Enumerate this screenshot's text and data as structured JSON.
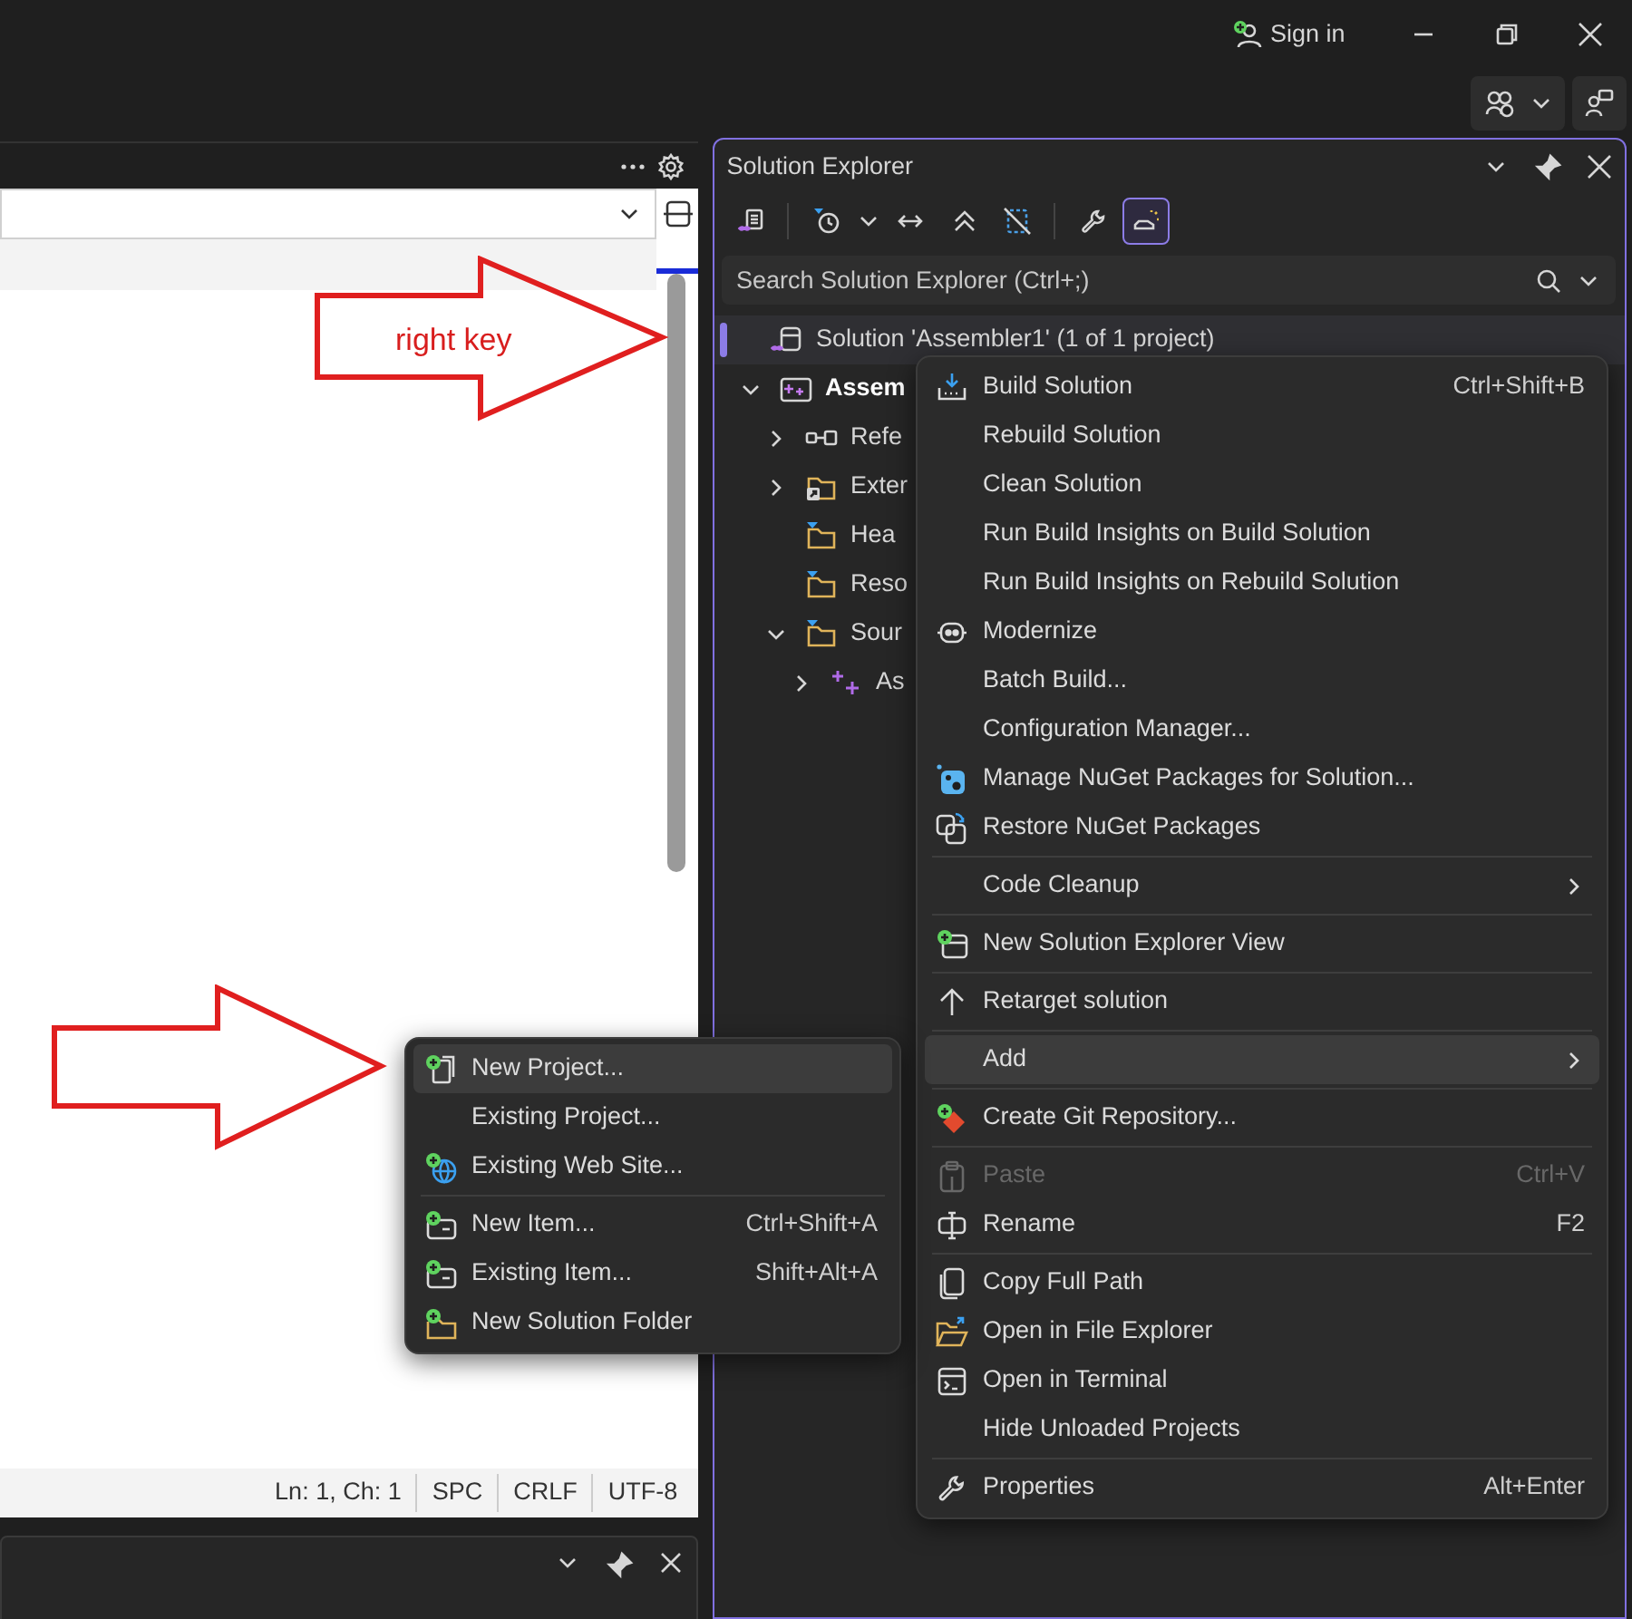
{
  "title_bar": {
    "sign_in": "Sign in"
  },
  "editor": {
    "status_bar": [
      "Ln: 1, Ch: 1",
      "SPC",
      "CRLF",
      "UTF-8"
    ]
  },
  "annotations": [
    {
      "kind": "labeled_arrow",
      "label": "right key"
    },
    {
      "kind": "arrow"
    }
  ],
  "solution_explorer": {
    "title": "Solution Explorer",
    "toolbar": [
      {
        "selected": false
      },
      {
        "selected": false
      },
      {
        "selected": false
      },
      {
        "selected": false
      },
      {
        "selected": false
      },
      {
        "selected": false
      },
      {
        "selected": true
      }
    ],
    "search": {
      "placeholder": "Search Solution Explorer (Ctrl+;)"
    },
    "tree": [
      {
        "kind": "solution",
        "label": "Solution 'Assembler1' (1 of 1 project)",
        "selected": true,
        "children": [
          {
            "kind": "project",
            "label": "Assem",
            "selected": false,
            "expanded": true,
            "children": [
              {
                "kind": "references",
                "label": "Refe",
                "selected": false,
                "expanded": false
              },
              {
                "kind": "external",
                "label": "Exter",
                "selected": false,
                "expanded": false
              },
              {
                "kind": "filter",
                "label": "Hea",
                "selected": false
              },
              {
                "kind": "filter",
                "label": "Reso",
                "selected": false
              },
              {
                "kind": "filter",
                "label": "Sour",
                "selected": false,
                "expanded": true,
                "children": [
                  {
                    "kind": "file",
                    "label": "As",
                    "selected": false,
                    "expanded": false
                  }
                ]
              }
            ]
          }
        ]
      }
    ]
  },
  "context_menu": {
    "items": [
      {
        "kind": "item",
        "label": "Build Solution",
        "shortcut": "Ctrl+Shift+B",
        "selected": false,
        "disabled": false,
        "submenu": false
      },
      {
        "kind": "item",
        "label": "Rebuild Solution",
        "selected": false,
        "disabled": false,
        "submenu": false
      },
      {
        "kind": "item",
        "label": "Clean Solution",
        "selected": false,
        "disabled": false,
        "submenu": false
      },
      {
        "kind": "item",
        "label": "Run Build Insights on Build Solution",
        "selected": false,
        "disabled": false,
        "submenu": false
      },
      {
        "kind": "item",
        "label": "Run Build Insights on Rebuild Solution",
        "selected": false,
        "disabled": false,
        "submenu": false
      },
      {
        "kind": "item",
        "label": "Modernize",
        "selected": false,
        "disabled": false,
        "submenu": false
      },
      {
        "kind": "item",
        "label": "Batch Build...",
        "selected": false,
        "disabled": false,
        "submenu": false
      },
      {
        "kind": "item",
        "label": "Configuration Manager...",
        "selected": false,
        "disabled": false,
        "submenu": false
      },
      {
        "kind": "item",
        "label": "Manage NuGet Packages for Solution...",
        "selected": false,
        "disabled": false,
        "submenu": false
      },
      {
        "kind": "item",
        "label": "Restore NuGet Packages",
        "selected": false,
        "disabled": false,
        "submenu": false
      },
      {
        "kind": "separator"
      },
      {
        "kind": "item",
        "label": "Code Cleanup",
        "selected": false,
        "disabled": false,
        "submenu": true
      },
      {
        "kind": "separator"
      },
      {
        "kind": "item",
        "label": "New Solution Explorer View",
        "selected": false,
        "disabled": false,
        "submenu": false
      },
      {
        "kind": "separator"
      },
      {
        "kind": "item",
        "label": "Retarget solution",
        "selected": false,
        "disabled": false,
        "submenu": false
      },
      {
        "kind": "separator"
      },
      {
        "kind": "item",
        "label": "Add",
        "selected": true,
        "disabled": false,
        "submenu": true
      },
      {
        "kind": "separator"
      },
      {
        "kind": "item",
        "label": "Create Git Repository...",
        "selected": false,
        "disabled": false,
        "submenu": false
      },
      {
        "kind": "separator"
      },
      {
        "kind": "item",
        "label": "Paste",
        "shortcut": "Ctrl+V",
        "selected": false,
        "disabled": true,
        "submenu": false
      },
      {
        "kind": "item",
        "label": "Rename",
        "shortcut": "F2",
        "selected": false,
        "disabled": false,
        "submenu": false
      },
      {
        "kind": "separator"
      },
      {
        "kind": "item",
        "label": "Copy Full Path",
        "selected": false,
        "disabled": false,
        "submenu": false
      },
      {
        "kind": "item",
        "label": "Open in File Explorer",
        "selected": false,
        "disabled": false,
        "submenu": false
      },
      {
        "kind": "item",
        "label": "Open in Terminal",
        "selected": false,
        "disabled": false,
        "submenu": false
      },
      {
        "kind": "item",
        "label": "Hide Unloaded Projects",
        "selected": false,
        "disabled": false,
        "submenu": false
      },
      {
        "kind": "separator"
      },
      {
        "kind": "item",
        "label": "Properties",
        "shortcut": "Alt+Enter",
        "selected": false,
        "disabled": false,
        "submenu": false
      }
    ]
  },
  "add_submenu": {
    "items": [
      {
        "kind": "item",
        "label": "New Project...",
        "selected": true,
        "disabled": false,
        "submenu": false
      },
      {
        "kind": "item",
        "label": "Existing Project...",
        "selected": false,
        "disabled": false,
        "submenu": false
      },
      {
        "kind": "item",
        "label": "Existing Web Site...",
        "selected": false,
        "disabled": false,
        "submenu": false
      },
      {
        "kind": "separator"
      },
      {
        "kind": "item",
        "label": "New Item...",
        "shortcut": "Ctrl+Shift+A",
        "selected": false,
        "disabled": false,
        "submenu": false
      },
      {
        "kind": "item",
        "label": "Existing Item...",
        "shortcut": "Shift+Alt+A",
        "selected": false,
        "disabled": false,
        "submenu": false
      },
      {
        "kind": "item",
        "label": "New Solution Folder",
        "selected": false,
        "disabled": false,
        "submenu": false
      }
    ]
  }
}
